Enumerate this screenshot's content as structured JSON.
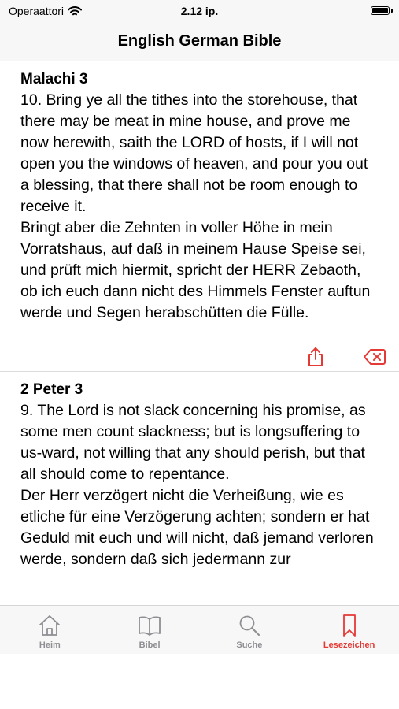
{
  "status_bar": {
    "carrier": "Operaattori",
    "time": "2.12 ip."
  },
  "nav": {
    "title": "English German Bible"
  },
  "bookmarks": [
    {
      "reference": "Malachi 3",
      "english": "10. Bring ye all the tithes into the storehouse, that there may be meat in mine house, and prove me now herewith, saith the LORD of hosts, if I will not open you the windows of heaven, and pour you out a blessing, that there shall not be room enough to receive it.",
      "german": "Bringt aber die Zehnten in voller Höhe in mein Vorratshaus, auf daß in meinem Hause Speise sei, und prüft mich hiermit, spricht der HERR Zebaoth, ob ich euch dann nicht des Himmels Fenster auftun werde und Segen herabschütten die Fülle."
    },
    {
      "reference": "2 Peter 3",
      "english": "9. The Lord is not slack concerning his promise, as some men count slackness; but is longsuffering to us-ward, not willing that any should perish, but that all should come to repentance.",
      "german": "Der Herr verzögert nicht die Verheißung, wie es etliche für eine Verzögerung achten; sondern er hat Geduld mit euch und will nicht, daß jemand verloren werde, sondern daß sich jedermann zur"
    }
  ],
  "tabs": [
    {
      "label": "Heim",
      "icon": "home-icon"
    },
    {
      "label": "Bibel",
      "icon": "book-icon"
    },
    {
      "label": "Suche",
      "icon": "search-icon"
    },
    {
      "label": "Lesezeichen",
      "icon": "bookmark-icon"
    }
  ],
  "colors": {
    "accent": "#e53935",
    "inactive": "#8e8e93",
    "bar_background": "#f7f7f7"
  }
}
